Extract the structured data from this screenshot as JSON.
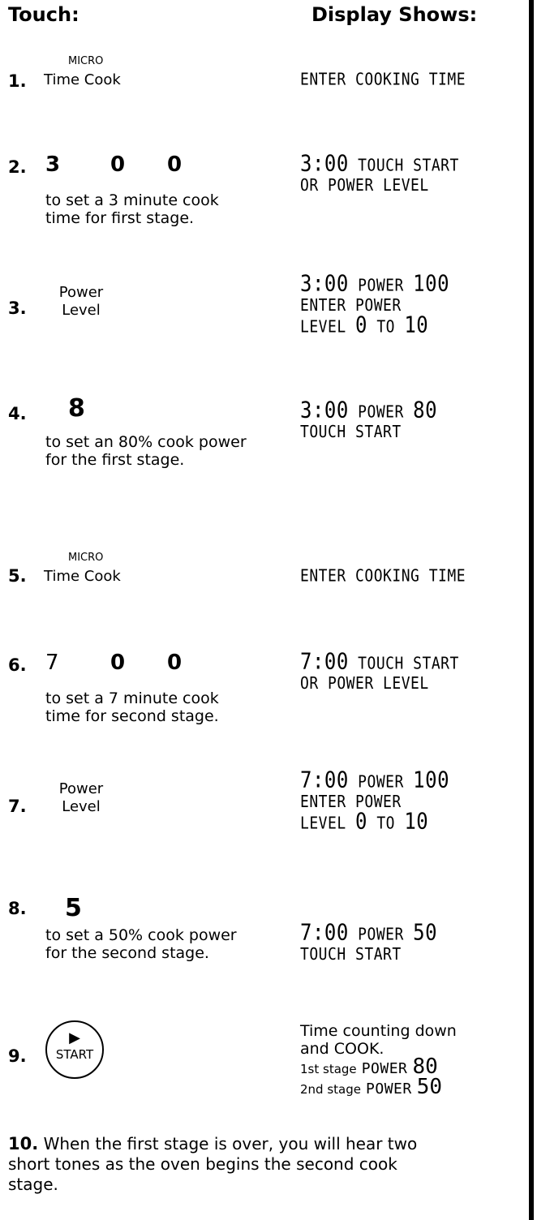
{
  "headers": {
    "touch": "Touch:",
    "display": "Display Shows:"
  },
  "steps": {
    "s1": {
      "num": "1.",
      "top_label": "MICRO",
      "label": "Time Cook",
      "display": [
        "ENTER COOKING TIME"
      ]
    },
    "s2": {
      "num": "2.",
      "keys": [
        "3",
        "0",
        "0"
      ],
      "note": "to set a 3 minute cook time for first stage.",
      "display_time": "3:00",
      "display_line1": "TOUCH START",
      "display_line2": "OR POWER LEVEL"
    },
    "s3": {
      "num": "3.",
      "label_line1": "Power",
      "label_line2": "Level",
      "display_time": "3:00",
      "display_power": "POWER",
      "display_value": "100",
      "display_line2": "ENTER POWER",
      "display_line3a": "LEVEL",
      "display_line3b": "0",
      "display_line3c": "TO",
      "display_line3d": "10"
    },
    "s4": {
      "num": "4.",
      "key": "8",
      "note": "to set an 80% cook power for the first stage.",
      "display_time": "3:00",
      "display_power": "POWER",
      "display_value": "80",
      "display_line2": "TOUCH START"
    },
    "s5": {
      "num": "5.",
      "top_label": "MICRO",
      "label": "Time Cook",
      "display": [
        "ENTER COOKING TIME"
      ]
    },
    "s6": {
      "num": "6.",
      "keys": [
        "7",
        "0",
        "0"
      ],
      "note": "to set a 7 minute cook time for second stage.",
      "display_time": "7:00",
      "display_line1": "TOUCH START",
      "display_line2": "OR POWER LEVEL"
    },
    "s7": {
      "num": "7.",
      "label_line1": "Power",
      "label_line2": "Level",
      "display_time": "7:00",
      "display_power": "POWER",
      "display_value": "100",
      "display_line2": "ENTER POWER",
      "display_line3a": "LEVEL",
      "display_line3b": "0",
      "display_line3c": "TO",
      "display_line3d": "10"
    },
    "s8": {
      "num": "8.",
      "key": "5",
      "note": "to set a 50% cook power for the second stage.",
      "display_time": "7:00",
      "display_power": "POWER",
      "display_value": "50",
      "display_line2": "TOUCH START"
    },
    "s9": {
      "num": "9.",
      "button_icon": "play-triangle-icon",
      "button_label": "START",
      "display_line1": "Time counting down",
      "display_line2": "and COOK.",
      "stage1_label": "1st stage",
      "stage1_power": "POWER",
      "stage1_value": "80",
      "stage2_label": "2nd stage",
      "stage2_power": "POWER",
      "stage2_value": "50"
    },
    "s10": {
      "num": "10.",
      "text": "When the first stage is over, you will hear two short tones as the oven begins the second cook stage."
    }
  }
}
